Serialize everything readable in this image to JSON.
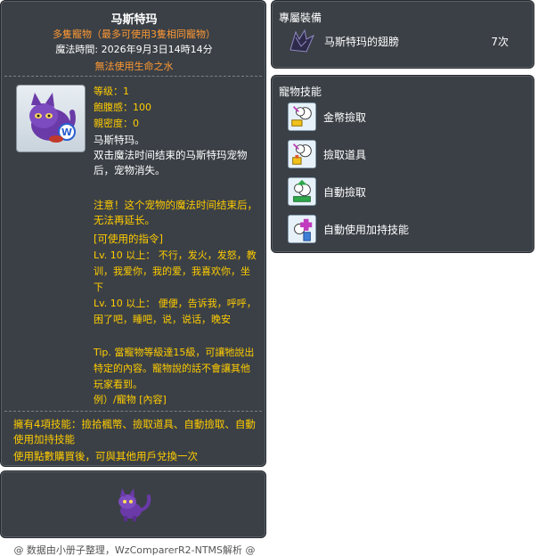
{
  "item_id": "05002302",
  "main": {
    "title": "马斯特玛",
    "subtitle": "多隻寵物（最多可使用3隻相同寵物）",
    "magic_time": "魔法時間: 2026年9月3日14時14分",
    "warning": "無法使用生命之水",
    "stats": {
      "level": "等级：1",
      "fullness": "飽腹感：100",
      "closeness": "親密度：0"
    },
    "desc": {
      "name": "马斯特玛。",
      "body": "双击魔法时间结束的马斯特玛宠物后，宠物消失。"
    },
    "note": "注意！这个宠物的魔法时间结束后，无法再延长。",
    "commands_head": "[可使用的指令]",
    "commands": [
      "Lv. 10 以上：  不行，发火，发怒，教训，我爱你，我的爱，我喜欢你，坐下",
      "Lv. 10 以上：  便便，告诉我，呼呼，困了吧，睡吧，说，说话，晚安"
    ],
    "tip": "Tip. 當寵物等級達15級，可讓牠說出特定的內容。寵物說的話不會讓其他玩家看到。",
    "example": "例）/寵物 [內容]",
    "skills_owned": "擁有4項技能：撿拾楓幣、撿取道具、自動撿取、自動使用加持技能",
    "exchange_note": "使用點數購買後，可與其他用戶兌換一次"
  },
  "equip": {
    "head": "專屬裝備",
    "item_label": "马斯特玛的翅膀",
    "item_count": "7次",
    "item_icon": "bat-wing-icon"
  },
  "skills": {
    "head": "寵物技能",
    "items": [
      {
        "label": "金幣撿取",
        "icon": "meso-pickup-icon"
      },
      {
        "label": "撿取道具",
        "icon": "item-pickup-icon"
      },
      {
        "label": "自動撿取",
        "icon": "auto-pickup-icon"
      },
      {
        "label": "自動使用加持技能",
        "icon": "auto-buff-icon"
      }
    ]
  },
  "footer": "@ 数据由小册子整理，WzComparerR2-NTMS解析 @",
  "colors": {
    "panel_bg": "#3b4046",
    "orange": "#ff9933",
    "gold": "#ffcc00",
    "white": "#ffffff"
  }
}
